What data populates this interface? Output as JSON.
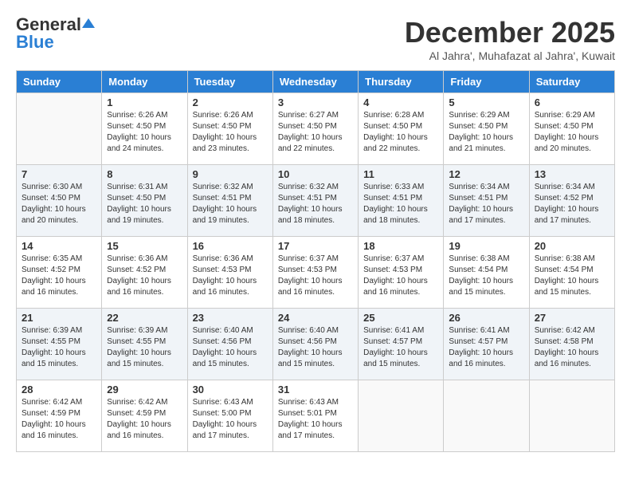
{
  "header": {
    "logo_general": "General",
    "logo_blue": "Blue",
    "month_title": "December 2025",
    "subtitle": "Al Jahra', Muhafazat al Jahra', Kuwait"
  },
  "days_of_week": [
    "Sunday",
    "Monday",
    "Tuesday",
    "Wednesday",
    "Thursday",
    "Friday",
    "Saturday"
  ],
  "weeks": [
    [
      {
        "day": "",
        "info": ""
      },
      {
        "day": "1",
        "info": "Sunrise: 6:26 AM\nSunset: 4:50 PM\nDaylight: 10 hours\nand 24 minutes."
      },
      {
        "day": "2",
        "info": "Sunrise: 6:26 AM\nSunset: 4:50 PM\nDaylight: 10 hours\nand 23 minutes."
      },
      {
        "day": "3",
        "info": "Sunrise: 6:27 AM\nSunset: 4:50 PM\nDaylight: 10 hours\nand 22 minutes."
      },
      {
        "day": "4",
        "info": "Sunrise: 6:28 AM\nSunset: 4:50 PM\nDaylight: 10 hours\nand 22 minutes."
      },
      {
        "day": "5",
        "info": "Sunrise: 6:29 AM\nSunset: 4:50 PM\nDaylight: 10 hours\nand 21 minutes."
      },
      {
        "day": "6",
        "info": "Sunrise: 6:29 AM\nSunset: 4:50 PM\nDaylight: 10 hours\nand 20 minutes."
      }
    ],
    [
      {
        "day": "7",
        "info": "Sunrise: 6:30 AM\nSunset: 4:50 PM\nDaylight: 10 hours\nand 20 minutes."
      },
      {
        "day": "8",
        "info": "Sunrise: 6:31 AM\nSunset: 4:50 PM\nDaylight: 10 hours\nand 19 minutes."
      },
      {
        "day": "9",
        "info": "Sunrise: 6:32 AM\nSunset: 4:51 PM\nDaylight: 10 hours\nand 19 minutes."
      },
      {
        "day": "10",
        "info": "Sunrise: 6:32 AM\nSunset: 4:51 PM\nDaylight: 10 hours\nand 18 minutes."
      },
      {
        "day": "11",
        "info": "Sunrise: 6:33 AM\nSunset: 4:51 PM\nDaylight: 10 hours\nand 18 minutes."
      },
      {
        "day": "12",
        "info": "Sunrise: 6:34 AM\nSunset: 4:51 PM\nDaylight: 10 hours\nand 17 minutes."
      },
      {
        "day": "13",
        "info": "Sunrise: 6:34 AM\nSunset: 4:52 PM\nDaylight: 10 hours\nand 17 minutes."
      }
    ],
    [
      {
        "day": "14",
        "info": "Sunrise: 6:35 AM\nSunset: 4:52 PM\nDaylight: 10 hours\nand 16 minutes."
      },
      {
        "day": "15",
        "info": "Sunrise: 6:36 AM\nSunset: 4:52 PM\nDaylight: 10 hours\nand 16 minutes."
      },
      {
        "day": "16",
        "info": "Sunrise: 6:36 AM\nSunset: 4:53 PM\nDaylight: 10 hours\nand 16 minutes."
      },
      {
        "day": "17",
        "info": "Sunrise: 6:37 AM\nSunset: 4:53 PM\nDaylight: 10 hours\nand 16 minutes."
      },
      {
        "day": "18",
        "info": "Sunrise: 6:37 AM\nSunset: 4:53 PM\nDaylight: 10 hours\nand 16 minutes."
      },
      {
        "day": "19",
        "info": "Sunrise: 6:38 AM\nSunset: 4:54 PM\nDaylight: 10 hours\nand 15 minutes."
      },
      {
        "day": "20",
        "info": "Sunrise: 6:38 AM\nSunset: 4:54 PM\nDaylight: 10 hours\nand 15 minutes."
      }
    ],
    [
      {
        "day": "21",
        "info": "Sunrise: 6:39 AM\nSunset: 4:55 PM\nDaylight: 10 hours\nand 15 minutes."
      },
      {
        "day": "22",
        "info": "Sunrise: 6:39 AM\nSunset: 4:55 PM\nDaylight: 10 hours\nand 15 minutes."
      },
      {
        "day": "23",
        "info": "Sunrise: 6:40 AM\nSunset: 4:56 PM\nDaylight: 10 hours\nand 15 minutes."
      },
      {
        "day": "24",
        "info": "Sunrise: 6:40 AM\nSunset: 4:56 PM\nDaylight: 10 hours\nand 15 minutes."
      },
      {
        "day": "25",
        "info": "Sunrise: 6:41 AM\nSunset: 4:57 PM\nDaylight: 10 hours\nand 15 minutes."
      },
      {
        "day": "26",
        "info": "Sunrise: 6:41 AM\nSunset: 4:57 PM\nDaylight: 10 hours\nand 16 minutes."
      },
      {
        "day": "27",
        "info": "Sunrise: 6:42 AM\nSunset: 4:58 PM\nDaylight: 10 hours\nand 16 minutes."
      }
    ],
    [
      {
        "day": "28",
        "info": "Sunrise: 6:42 AM\nSunset: 4:59 PM\nDaylight: 10 hours\nand 16 minutes."
      },
      {
        "day": "29",
        "info": "Sunrise: 6:42 AM\nSunset: 4:59 PM\nDaylight: 10 hours\nand 16 minutes."
      },
      {
        "day": "30",
        "info": "Sunrise: 6:43 AM\nSunset: 5:00 PM\nDaylight: 10 hours\nand 17 minutes."
      },
      {
        "day": "31",
        "info": "Sunrise: 6:43 AM\nSunset: 5:01 PM\nDaylight: 10 hours\nand 17 minutes."
      },
      {
        "day": "",
        "info": ""
      },
      {
        "day": "",
        "info": ""
      },
      {
        "day": "",
        "info": ""
      }
    ]
  ]
}
